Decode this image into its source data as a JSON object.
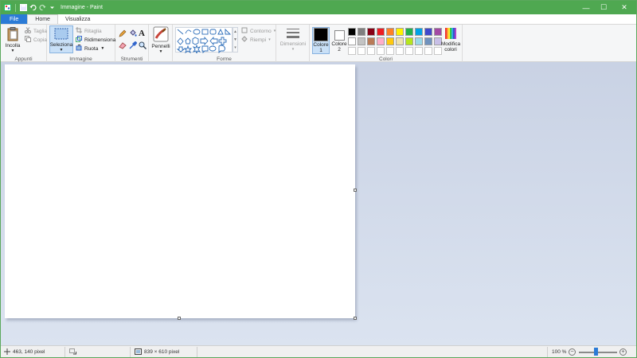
{
  "window": {
    "title": "Immagine - Paint",
    "controls": {
      "minimize": "—",
      "maximize": "☐",
      "close": "✕"
    }
  },
  "qat": {
    "icons": [
      "paint-app-icon",
      "save-icon",
      "undo-icon",
      "redo-icon",
      "customize-qat-icon"
    ]
  },
  "tabs": [
    {
      "label": "File"
    },
    {
      "label": "Home"
    },
    {
      "label": "Visualizza"
    }
  ],
  "ribbon": {
    "appunti": {
      "label": "Appunti",
      "paste": "Incolla",
      "cut": "Taglia",
      "copy": "Copia"
    },
    "immagine": {
      "label": "Immagine",
      "select": "Seleziona",
      "crop": "Ritaglia",
      "resize": "Ridimensiona",
      "rotate": "Ruota"
    },
    "strumenti": {
      "label": "Strumenti"
    },
    "pennelli": {
      "label": "Pennelli"
    },
    "forme": {
      "label": "Forme",
      "outline": "Contorno",
      "fill": "Riempi"
    },
    "dimensioni": {
      "label": "Dimensioni"
    },
    "colori": {
      "label": "Colori",
      "color1": "Colore\n1",
      "color1_a": "Colore",
      "color1_b": "1",
      "color2_a": "Colore",
      "color2_b": "2",
      "edit_a": "Modifica",
      "edit_b": "colori",
      "color1_value": "#000000",
      "color2_value": "#ffffff",
      "palette_row1": [
        "#000000",
        "#7f7f7f",
        "#880015",
        "#ed1c24",
        "#ff7f27",
        "#fff200",
        "#22b14c",
        "#00a2e8",
        "#3f48cc",
        "#a349a4"
      ],
      "palette_row2": [
        "#ffffff",
        "#c3c3c3",
        "#b97a57",
        "#ffaec9",
        "#ffc90e",
        "#efe4b0",
        "#b5e61d",
        "#99d9ea",
        "#7092be",
        "#c8bfe7"
      ],
      "palette_row3": [
        "#ffffff",
        "#ffffff",
        "#ffffff",
        "#ffffff",
        "#ffffff",
        "#ffffff",
        "#ffffff",
        "#ffffff",
        "#ffffff",
        "#ffffff"
      ]
    }
  },
  "statusbar": {
    "cursor_pos": "463, 140 pixel",
    "selection_size": "",
    "image_size": "839 × 610 pixel",
    "zoom": "100 %"
  }
}
